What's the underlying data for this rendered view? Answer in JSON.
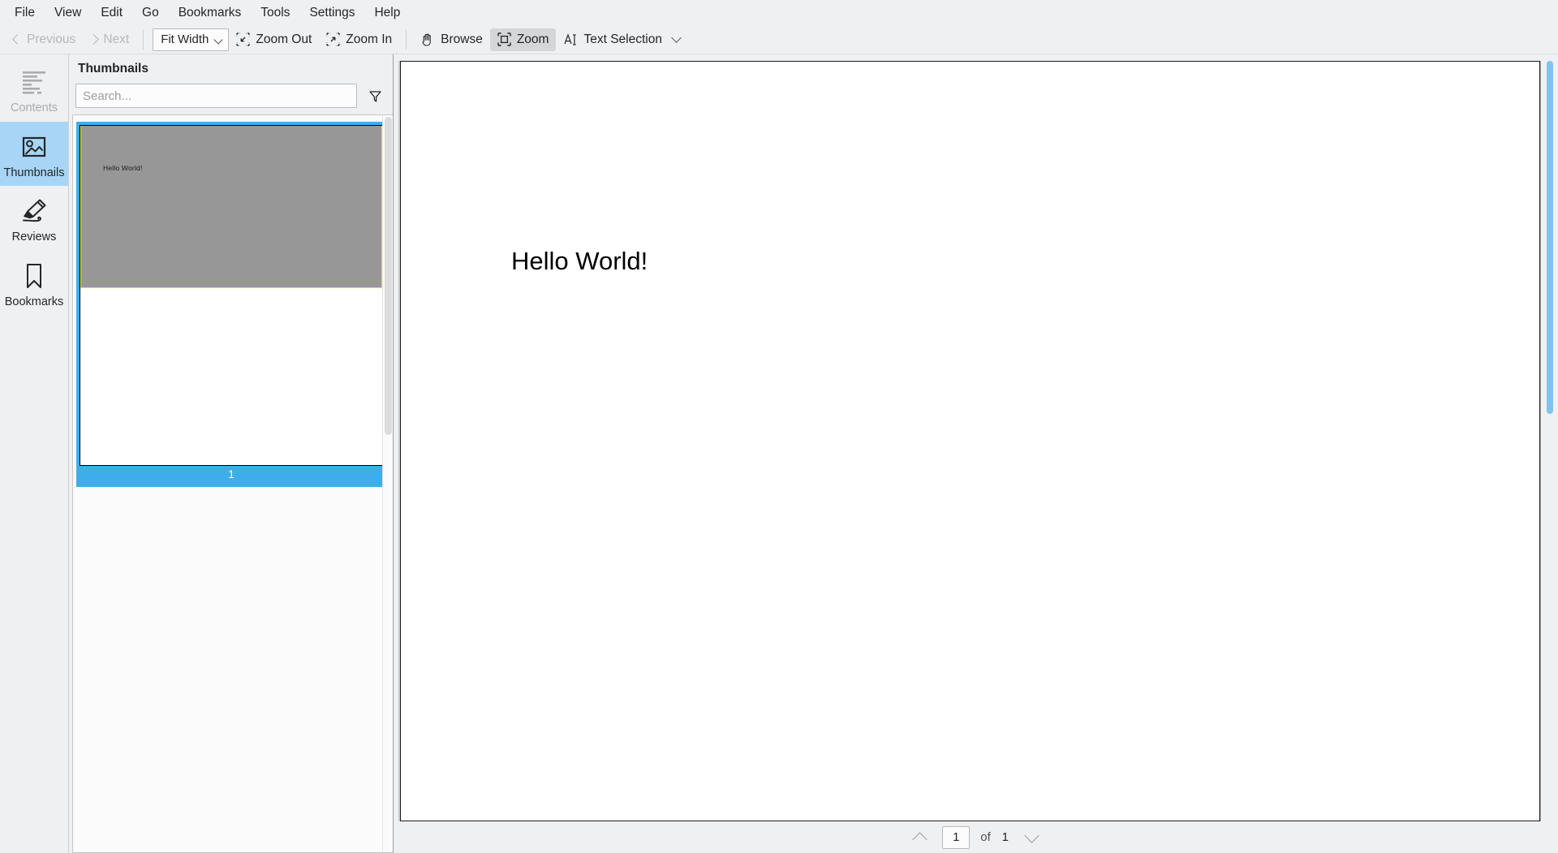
{
  "menubar": {
    "items": [
      {
        "label": "File"
      },
      {
        "label": "View"
      },
      {
        "label": "Edit"
      },
      {
        "label": "Go"
      },
      {
        "label": "Bookmarks"
      },
      {
        "label": "Tools"
      },
      {
        "label": "Settings"
      },
      {
        "label": "Help"
      }
    ]
  },
  "toolbar": {
    "previous_label": "Previous",
    "next_label": "Next",
    "zoom_mode_value": "Fit Width",
    "zoom_out_label": "Zoom Out",
    "zoom_in_label": "Zoom In",
    "browse_label": "Browse",
    "zoom_label": "Zoom",
    "text_selection_label": "Text Selection"
  },
  "rail": {
    "items": [
      {
        "label": "Contents",
        "icon": "contents-icon",
        "state": "disabled"
      },
      {
        "label": "Thumbnails",
        "icon": "thumbnails-icon",
        "state": "selected"
      },
      {
        "label": "Reviews",
        "icon": "highlighter-icon",
        "state": "normal"
      },
      {
        "label": "Bookmarks",
        "icon": "bookmark-icon",
        "state": "normal"
      }
    ]
  },
  "thumbnails_panel": {
    "title": "Thumbnails",
    "search_placeholder": "Search...",
    "search_value": "",
    "filter_icon": "filter-funnel-icon",
    "pages": [
      {
        "number": "1",
        "text": "Hello World!"
      }
    ]
  },
  "document": {
    "text": "Hello World!"
  },
  "pagebar": {
    "current_page": "1",
    "of_label": "of",
    "total_pages": "1",
    "prev_icon": "chevron-up-icon",
    "next_icon": "chevron-down-icon"
  },
  "colors": {
    "selection_blue": "#3daee9",
    "rail_selected": "#a8d5f5",
    "viewport_grey": "#979797",
    "viewport_outline_yellow": "#e7e034",
    "chrome_grey": "#eff0f1",
    "scroll_blue": "#7ec4ef"
  }
}
